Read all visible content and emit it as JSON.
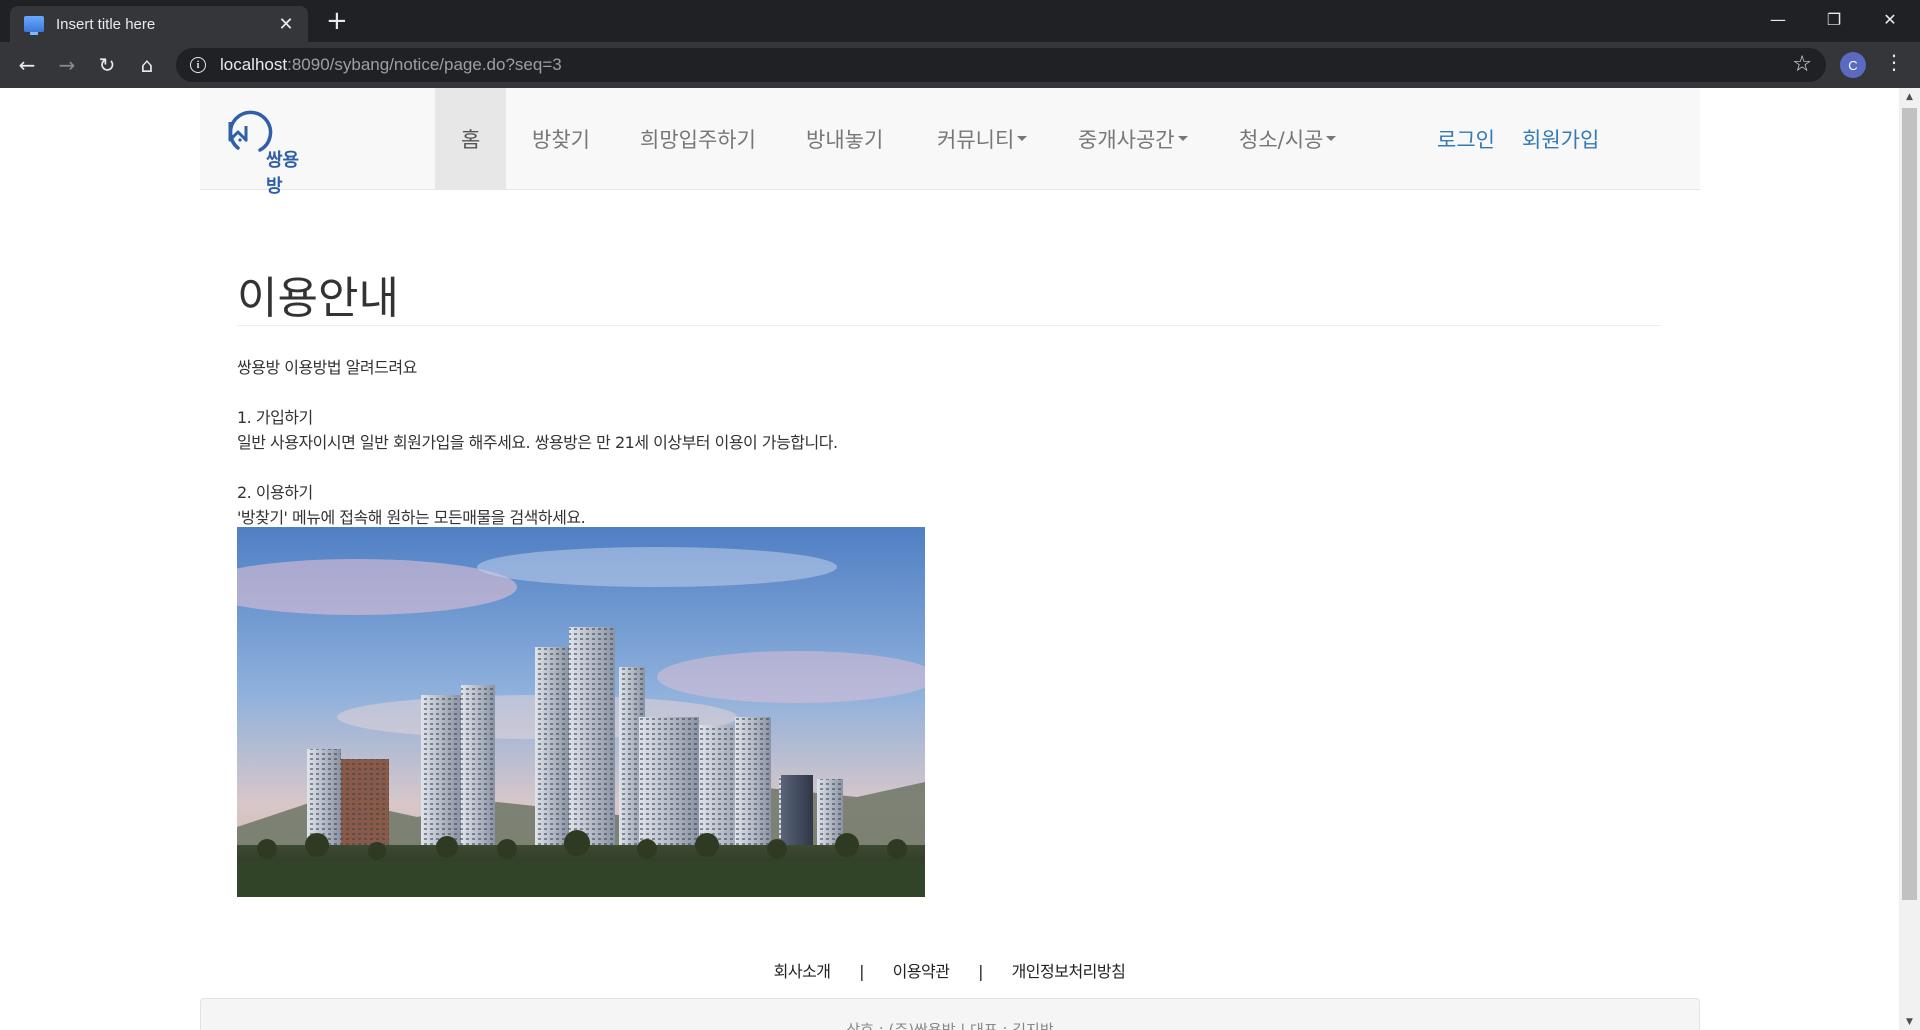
{
  "browser": {
    "tab_title": "Insert title here",
    "new_tab": "+",
    "close_tab": "✕",
    "url_host": "localhost",
    "url_path": ":8090/sybang/notice/page.do?seq=3",
    "profile_initial": "C",
    "window_controls": {
      "minimize": "—",
      "restore": "❐",
      "close": "✕"
    },
    "nav_icons": {
      "back": "←",
      "forward": "→",
      "reload": "↻",
      "home": "⌂",
      "star": "☆",
      "menu": "⋮"
    }
  },
  "site": {
    "logo_text": "쌍용방",
    "nav": [
      {
        "label": "홈",
        "active": true
      },
      {
        "label": "방찾기"
      },
      {
        "label": "희망입주하기"
      },
      {
        "label": "방내놓기"
      },
      {
        "label": "커뮤니티",
        "dropdown": true
      },
      {
        "label": "중개사공간",
        "dropdown": true
      },
      {
        "label": "청소/시공",
        "dropdown": true
      }
    ],
    "auth": {
      "login": "로그인",
      "signup": "회원가입"
    }
  },
  "content": {
    "title": "이용안내",
    "intro": "쌍용방 이용방법 알려드려요",
    "step1_title": "1. 가입하기",
    "step1_body": "일반 사용자이시면 일반 회원가입을 해주세요. 쌍용방은 만 21세 이상부터 이용이 가능합니다.",
    "step2_title": "2. 이용하기",
    "step2_body": "'방찾기' 메뉴에 접속해 원하는 모든매물을 검색하세요."
  },
  "footer": {
    "links": [
      "회사소개",
      "이용약관",
      "개인정보처리방침"
    ],
    "separator": "|",
    "company": "상호 : (주)쌍용방 | 대표 : 김지방"
  },
  "colors": {
    "link_blue": "#337ab7",
    "nav_gray": "#777777",
    "navbar_bg": "#f8f8f8",
    "active_bg": "#e7e7e7"
  }
}
